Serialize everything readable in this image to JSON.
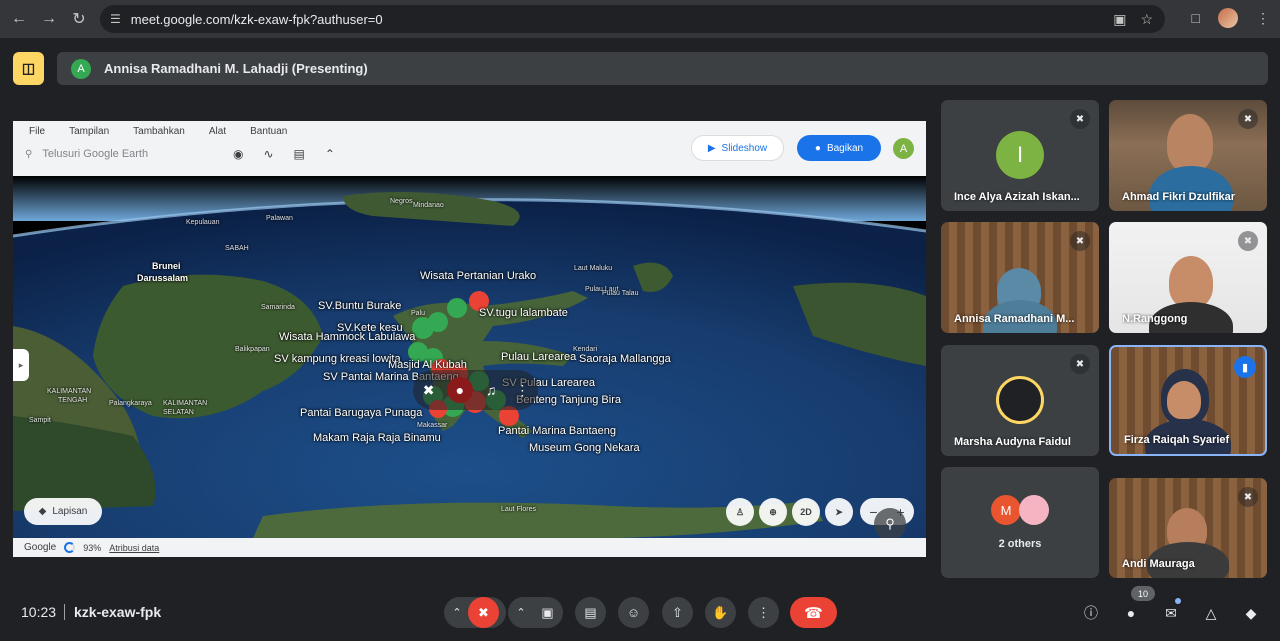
{
  "browser": {
    "url": "meet.google.com/kzk-exaw-fpk?authuser=0",
    "icons": [
      "back-icon",
      "forward-icon",
      "reload-icon",
      "site-info-icon",
      "camera-icon",
      "star-icon",
      "extensions-icon",
      "profile-avatar",
      "more-icon"
    ]
  },
  "presenting": {
    "avatar_letter": "A",
    "text": "Annisa Ramadhani M. Lahadji (Presenting)"
  },
  "earth": {
    "menu": [
      "File",
      "Tampilan",
      "Tambahkan",
      "Alat",
      "Bantuan"
    ],
    "search_placeholder": "Telusuri Google Earth",
    "slideshow_label": "Slideshow",
    "share_label": "Bagikan",
    "avatar_letter": "A",
    "layers_label": "Lapisan",
    "view_2d": "2D",
    "footer_brand": "Google",
    "footer_percent": "93%",
    "footer_attr": "Atribusi data",
    "labels": {
      "brunei": "Brunei",
      "darussalam": "Darussalam",
      "kepulauan": "Kepulauan",
      "palawan": "Palawan",
      "sabah": "SABAH",
      "negros": "Negros",
      "mindanao": "Mindanao",
      "urako": "Wisata Pertanian Urako",
      "laut_maluku": "Laut Maluku",
      "pulau_laut": "Pulau Laut",
      "pulau_talau": "Pulau Talau",
      "buntu": "SV.Buntu Burake",
      "tugu": "SV.tugu lalambate",
      "samarinda": "Samarinda",
      "palu": "Palu",
      "hammock": "Wisata Hammock Labulawa",
      "kete_kesu": "SV.Kete kesu",
      "balikpapan": "Balikpapan",
      "kampung": "SV kampung kreasi lowita",
      "museum": "Pulau Larearea",
      "saoraja": "Saoraja Mallangga",
      "kendari": "Kendari",
      "marina_bantaeng_sv": "SV Pantai Marina Bantaeng",
      "masjid": "Masjid Al Kubah",
      "larearea": "SV Pulau Larearea",
      "benteng": "Benteng Tanjung Bira",
      "barugaya": "Pantai Barugaya Punaga",
      "makassar": "Makassar",
      "marina": "Pantai Marina Bantaeng",
      "raja": "Makam Raja Raja Binamu",
      "gong": "Museum Gong Nekara",
      "kalimantan_tengah_1": "KALIMANTAN",
      "kalimantan_tengah_2": "TENGAH",
      "palangkaraya": "Palangkaraya",
      "kalsel_1": "KALIMANTAN",
      "kalsel_2": "SELATAN",
      "sampit": "Sampit",
      "laut_flores": "Laut Flores"
    }
  },
  "tiles": [
    {
      "name": "Ince Alya Azizah Iskan...",
      "avatar": "I",
      "avatar_color": "#7cb342"
    },
    {
      "name": "Ahmad Fikri Dzulfikar"
    },
    {
      "name": "Annisa Ramadhani M..."
    },
    {
      "name": "N.Ranggong"
    },
    {
      "name": "Marsha Audyna Faidul"
    },
    {
      "name": "Firza Raiqah Syarief"
    },
    {
      "name": "2 others",
      "avatar_m": "M"
    },
    {
      "name": "Andi Mauraga"
    }
  ],
  "bottom": {
    "time": "10:23",
    "meeting_code": "kzk-exaw-fpk",
    "people_count": "10"
  },
  "colors": {
    "accent": "#1a73e8",
    "danger": "#ea4335",
    "present_badge": "#fdd663"
  }
}
